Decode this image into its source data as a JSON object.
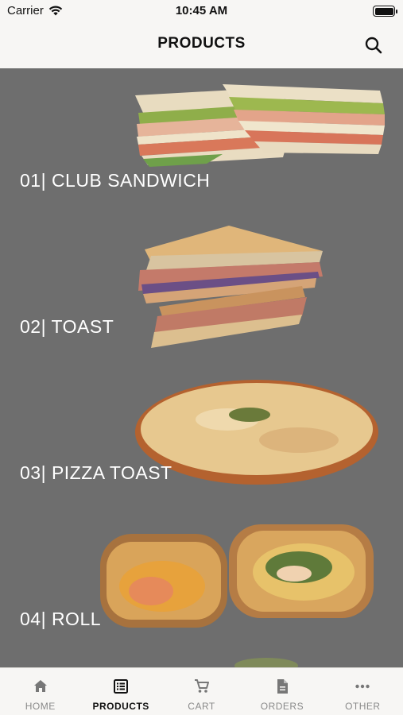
{
  "status_bar": {
    "carrier": "Carrier",
    "time": "10:45 AM"
  },
  "nav": {
    "title": "PRODUCTS"
  },
  "products": [
    {
      "label": "01| CLUB SANDWICH"
    },
    {
      "label": "02| TOAST"
    },
    {
      "label": "03| PIZZA TOAST"
    },
    {
      "label": "04| ROLL"
    }
  ],
  "tabs": [
    {
      "label": "HOME",
      "icon": "home-icon",
      "active": false
    },
    {
      "label": "PRODUCTS",
      "icon": "list-icon",
      "active": true
    },
    {
      "label": "CART",
      "icon": "cart-icon",
      "active": false
    },
    {
      "label": "ORDERS",
      "icon": "document-icon",
      "active": false
    },
    {
      "label": "OTHER",
      "icon": "more-icon",
      "active": false
    }
  ],
  "colors": {
    "background": "#f7f6f4",
    "content_overlay": "#6e6e6e",
    "text_white": "#ffffff",
    "inactive": "#8a8a8a"
  }
}
